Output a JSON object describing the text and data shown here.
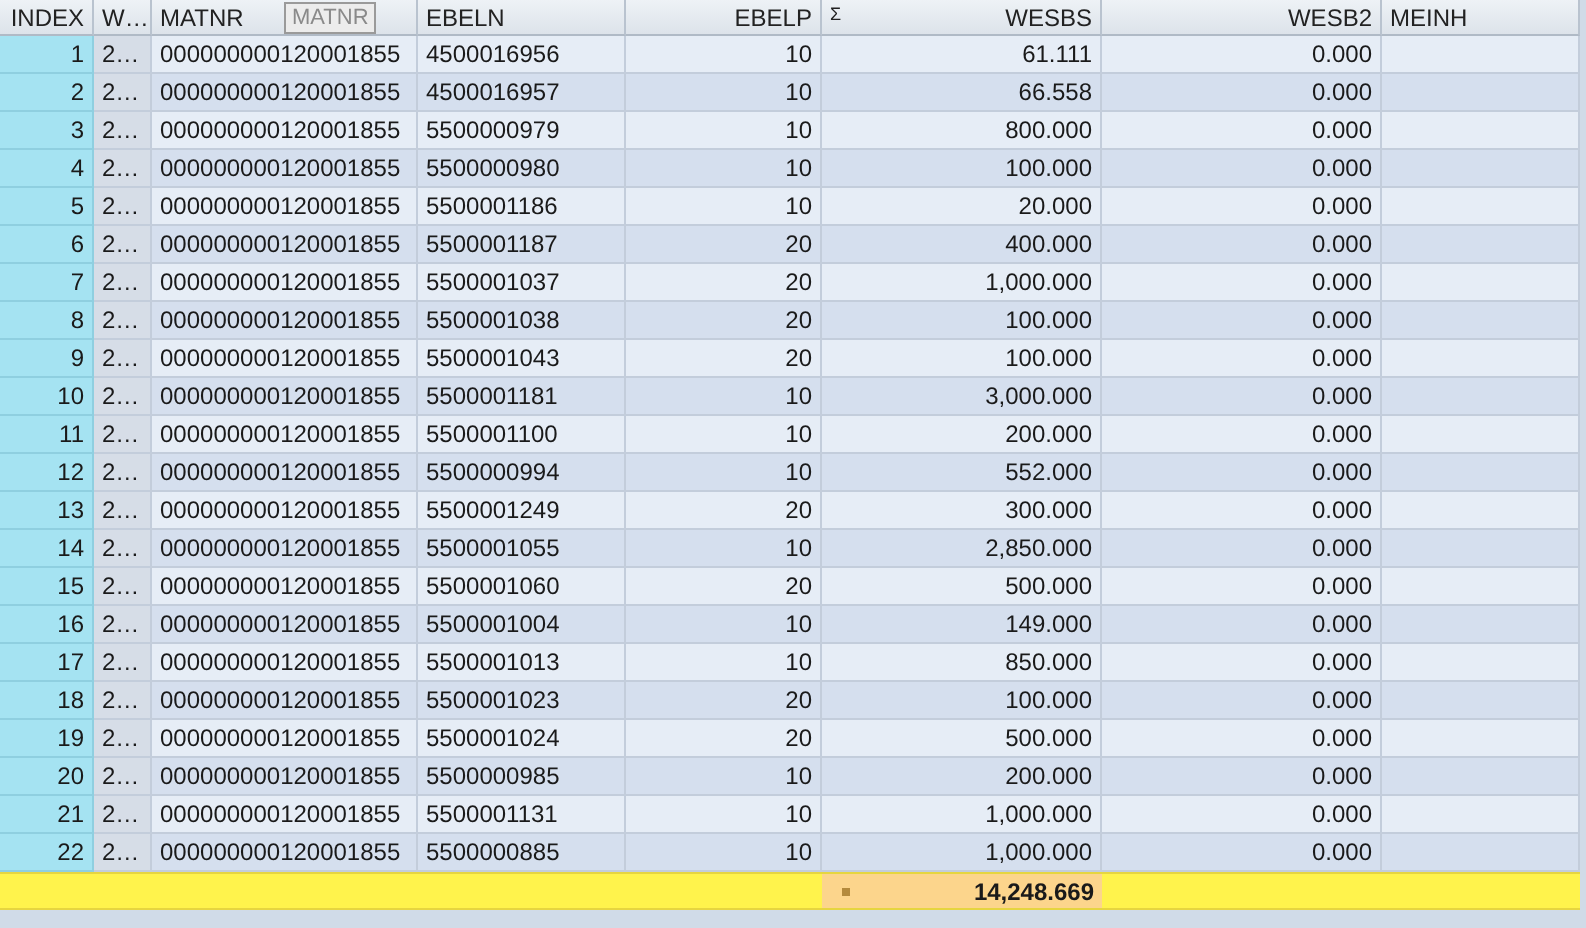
{
  "table": {
    "columns": [
      {
        "label": "INDEX"
      },
      {
        "label": "W…"
      },
      {
        "label": "MATNR"
      },
      {
        "label": "EBELN"
      },
      {
        "label": "EBELP"
      },
      {
        "label": "WESBS",
        "sum_mark": "Σ"
      },
      {
        "label": "WESB2"
      },
      {
        "label": "MEINH"
      }
    ],
    "rows": [
      [
        "1",
        "2…",
        "000000000120001855",
        "4500016956",
        "10",
        "61.111",
        "0.000"
      ],
      [
        "2",
        "2…",
        "000000000120001855",
        "4500016957",
        "10",
        "66.558",
        "0.000"
      ],
      [
        "3",
        "2…",
        "000000000120001855",
        "5500000979",
        "10",
        "800.000",
        "0.000"
      ],
      [
        "4",
        "2…",
        "000000000120001855",
        "5500000980",
        "10",
        "100.000",
        "0.000"
      ],
      [
        "5",
        "2…",
        "000000000120001855",
        "5500001186",
        "10",
        "20.000",
        "0.000"
      ],
      [
        "6",
        "2…",
        "000000000120001855",
        "5500001187",
        "20",
        "400.000",
        "0.000"
      ],
      [
        "7",
        "2…",
        "000000000120001855",
        "5500001037",
        "20",
        "1,000.000",
        "0.000"
      ],
      [
        "8",
        "2…",
        "000000000120001855",
        "5500001038",
        "20",
        "100.000",
        "0.000"
      ],
      [
        "9",
        "2…",
        "000000000120001855",
        "5500001043",
        "20",
        "100.000",
        "0.000"
      ],
      [
        "10",
        "2…",
        "000000000120001855",
        "5500001181",
        "10",
        "3,000.000",
        "0.000"
      ],
      [
        "11",
        "2…",
        "000000000120001855",
        "5500001100",
        "10",
        "200.000",
        "0.000"
      ],
      [
        "12",
        "2…",
        "000000000120001855",
        "5500000994",
        "10",
        "552.000",
        "0.000"
      ],
      [
        "13",
        "2…",
        "000000000120001855",
        "5500001249",
        "20",
        "300.000",
        "0.000"
      ],
      [
        "14",
        "2…",
        "000000000120001855",
        "5500001055",
        "10",
        "2,850.000",
        "0.000"
      ],
      [
        "15",
        "2…",
        "000000000120001855",
        "5500001060",
        "20",
        "500.000",
        "0.000"
      ],
      [
        "16",
        "2…",
        "000000000120001855",
        "5500001004",
        "10",
        "149.000",
        "0.000"
      ],
      [
        "17",
        "2…",
        "000000000120001855",
        "5500001013",
        "10",
        "850.000",
        "0.000"
      ],
      [
        "18",
        "2…",
        "000000000120001855",
        "5500001023",
        "20",
        "100.000",
        "0.000"
      ],
      [
        "19",
        "2…",
        "000000000120001855",
        "5500001024",
        "20",
        "500.000",
        "0.000"
      ],
      [
        "20",
        "2…",
        "000000000120001855",
        "5500000985",
        "10",
        "200.000",
        "0.000"
      ],
      [
        "21",
        "2…",
        "000000000120001855",
        "5500001131",
        "10",
        "1,000.000",
        "0.000"
      ],
      [
        "22",
        "2…",
        "000000000120001855",
        "5500000885",
        "10",
        "1,000.000",
        "0.000"
      ]
    ],
    "total": {
      "value": "14,248.669"
    },
    "tooltip": {
      "text": "MATNR"
    }
  }
}
